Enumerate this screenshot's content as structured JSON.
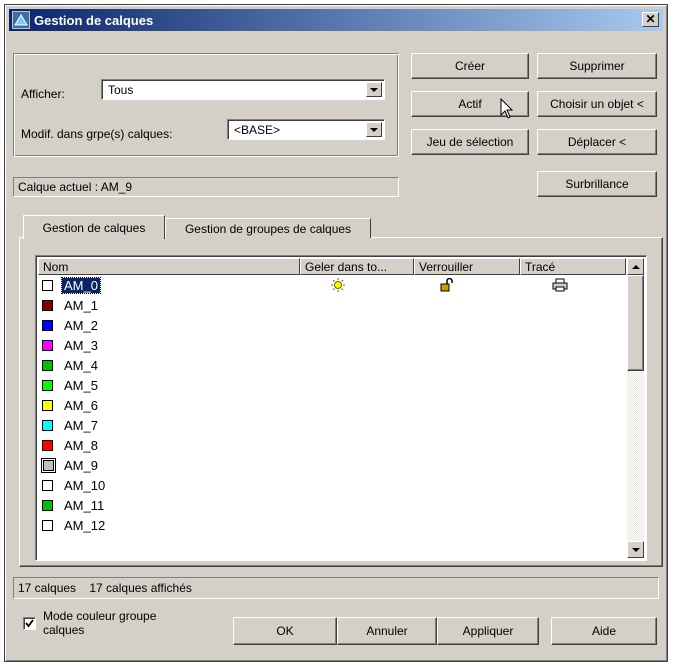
{
  "window": {
    "title": "Gestion de calques"
  },
  "filters": {
    "afficher_label": "Afficher:",
    "afficher_value": "Tous",
    "modif_label": "Modif. dans grpe(s) calques:",
    "modif_value": "<BASE>"
  },
  "buttons": {
    "creer": "Créer",
    "supprimer": "Supprimer",
    "actif": "Actif",
    "choisir": "Choisir un objet <",
    "jeu": "Jeu de sélection",
    "deplacer": "Déplacer <",
    "surbrillance": "Surbrillance"
  },
  "current_layer": "Calque actuel : AM_9",
  "tabs": [
    {
      "label": "Gestion de calques",
      "active": true
    },
    {
      "label": "Gestion de groupes de calques",
      "active": false
    }
  ],
  "list": {
    "columns": [
      "Nom",
      "Geler dans to...",
      "Verrouiller",
      "Tracé"
    ],
    "rows": [
      {
        "name": "AM_0",
        "color": "#ffffff",
        "selected": true
      },
      {
        "name": "AM_1",
        "color": "#800000"
      },
      {
        "name": "AM_2",
        "color": "#0000ff"
      },
      {
        "name": "AM_3",
        "color": "#ff00ff"
      },
      {
        "name": "AM_4",
        "color": "#00c000"
      },
      {
        "name": "AM_5",
        "color": "#00ff00"
      },
      {
        "name": "AM_6",
        "color": "#ffff00"
      },
      {
        "name": "AM_7",
        "color": "#00ffff"
      },
      {
        "name": "AM_8",
        "color": "#ff0000"
      },
      {
        "name": "AM_9",
        "color": "#c0c0c0"
      },
      {
        "name": "AM_10",
        "color": "#ffffff"
      },
      {
        "name": "AM_11",
        "color": "#00c000"
      },
      {
        "name": "AM_12",
        "color": "#ffffff"
      }
    ]
  },
  "status": "17 calques    17 calques affichés",
  "checkbox": {
    "label": "Mode couleur groupe calques",
    "checked": true
  },
  "footer": {
    "ok": "OK",
    "annuler": "Annuler",
    "appliquer": "Appliquer",
    "aide": "Aide"
  }
}
